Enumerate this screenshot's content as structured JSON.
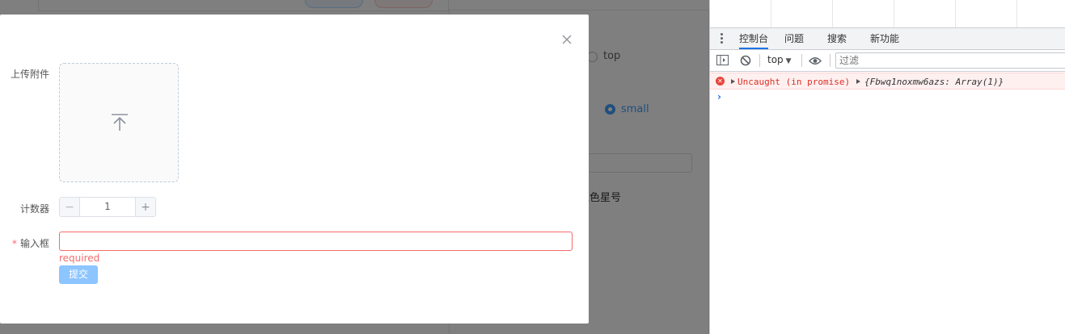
{
  "background": {
    "radio_top_label": "top",
    "radio_small_label": "small",
    "star_label": "红色星号"
  },
  "dialog": {
    "upload_label": "上传附件",
    "counter_label": "计数器",
    "counter_value": "1",
    "input_required_star": "*",
    "input_label": "输入框",
    "input_value": "",
    "error_message": "required",
    "submit_label": "提交"
  },
  "devtools": {
    "tabs": [
      "控制台",
      "问题",
      "搜索",
      "新功能"
    ],
    "active_tab": "控制台",
    "context": "top",
    "filter_placeholder": "过滤",
    "error_text": "Uncaught (in promise)",
    "error_object": "{Fbwq1noxmw6azs: Array(1)}",
    "icons": [
      "sidebar-toggle-icon",
      "clear-console-icon",
      "eye-icon",
      "error-icon",
      "expand-triangle-icon",
      "prompt-chevron-icon"
    ]
  },
  "colors": {
    "accent": "#409eff",
    "error": "#f56c6c",
    "submit_disabled": "#8cc5ff",
    "devtools_accent": "#1a73e8"
  }
}
